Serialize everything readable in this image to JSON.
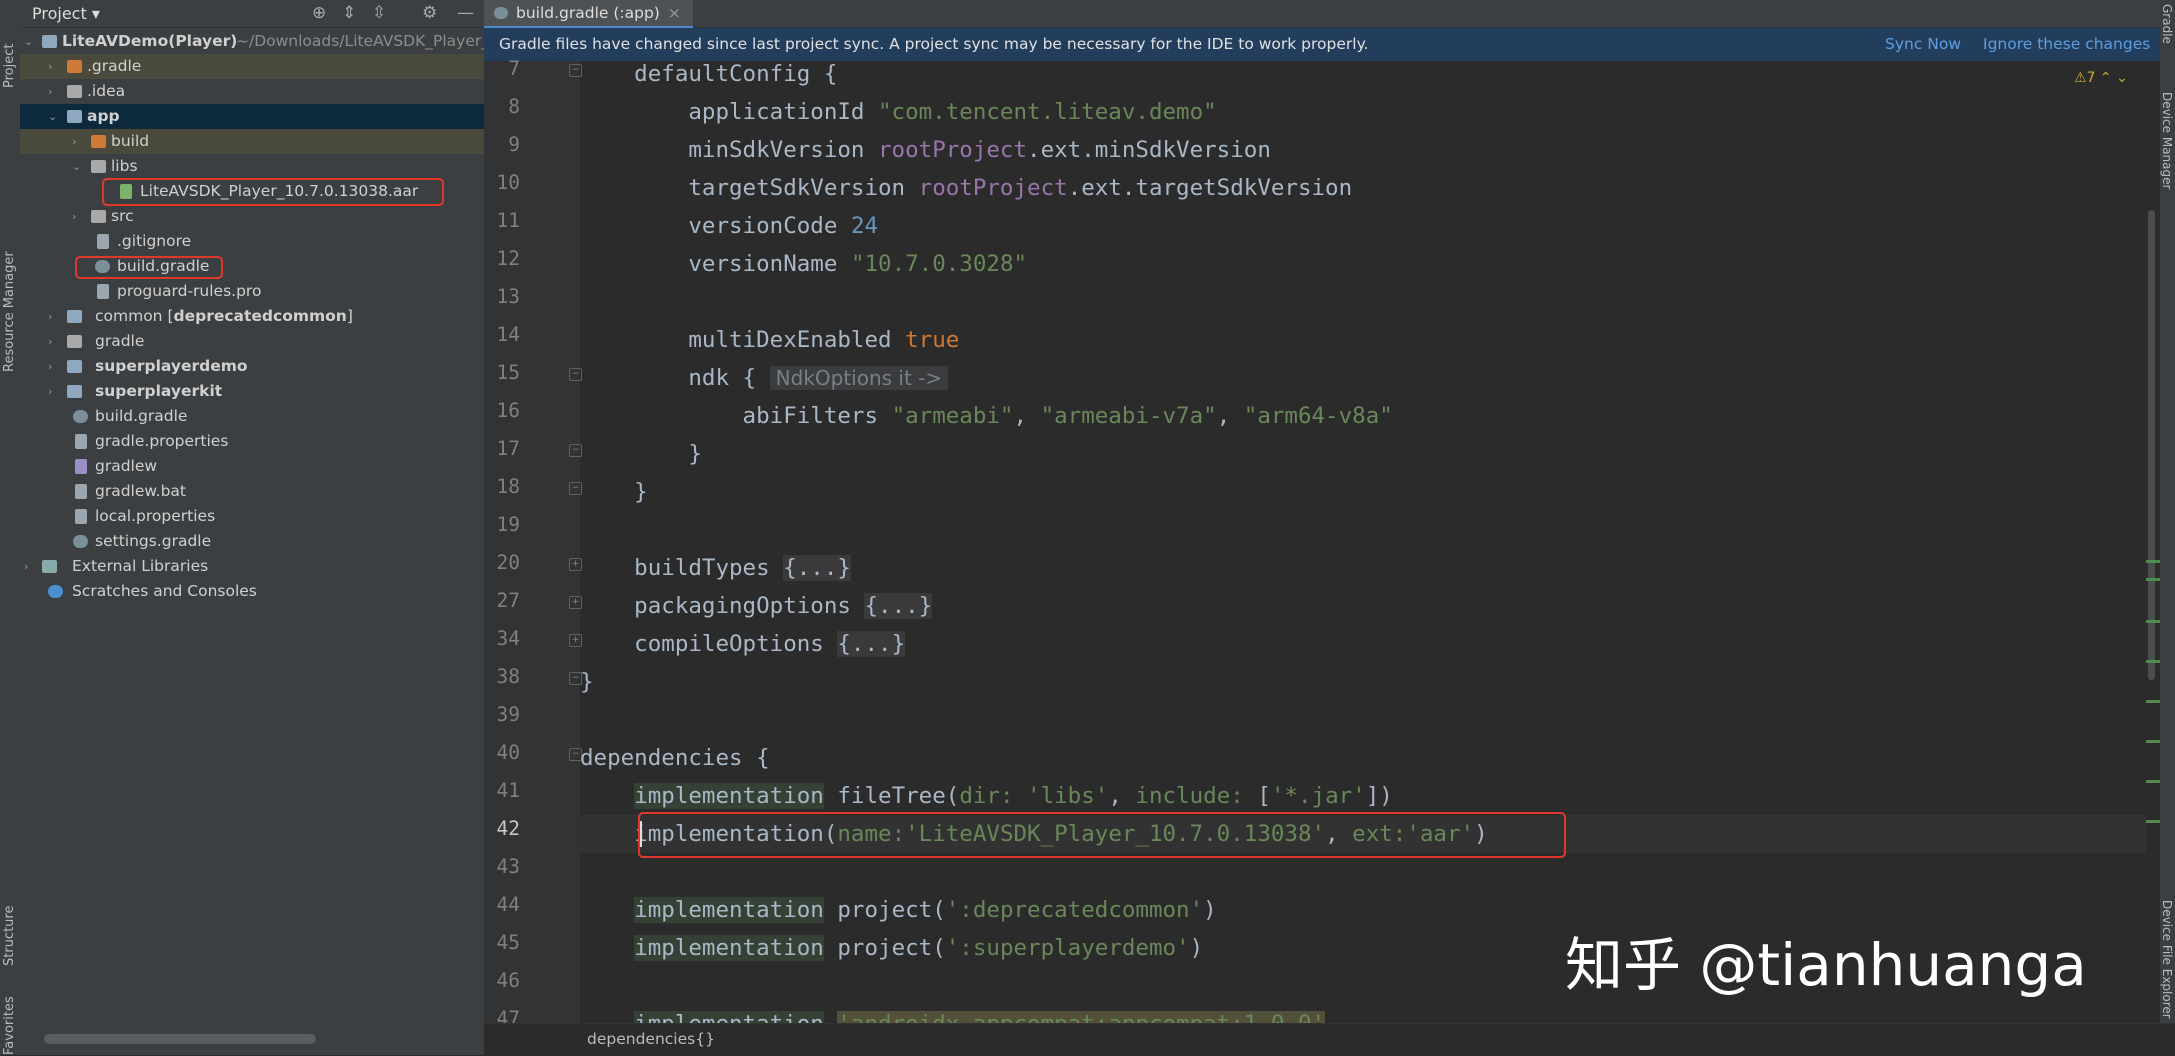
{
  "left_strip": {
    "tabs": [
      "Project",
      "Resource Manager",
      "Structure",
      "Favorites"
    ]
  },
  "right_strip": {
    "tabs": [
      "Gradle",
      "Device Manager",
      "Device File Explorer"
    ]
  },
  "project_panel": {
    "title": "Project",
    "title_arrow": "▾",
    "toolbar": {
      "locate": "⊕",
      "expand": "⇕",
      "collapse": "⇳",
      "settings": "⚙",
      "hide": "—"
    },
    "items": [
      {
        "label": "LiteAVDemo(Player)",
        "suffix": " ~/Downloads/LiteAVSDK_Player_A",
        "arrow": "⌄"
      },
      {
        "label": ".gradle",
        "arrow": "›"
      },
      {
        "label": ".idea",
        "arrow": "›"
      },
      {
        "label": "app",
        "arrow": "⌄"
      },
      {
        "label": "build",
        "arrow": "›"
      },
      {
        "label": "libs",
        "arrow": "⌄"
      },
      {
        "label": "LiteAVSDK_Player_10.7.0.13038.aar"
      },
      {
        "label": "src",
        "arrow": "›"
      },
      {
        "label": ".gitignore"
      },
      {
        "label": "build.gradle"
      },
      {
        "label": "proguard-rules.pro"
      },
      {
        "label": "common",
        "suffix_open": " [",
        "suffix_bold": "deprecatedcommon",
        "suffix_close": "]",
        "arrow": "›"
      },
      {
        "label": "gradle",
        "arrow": "›"
      },
      {
        "label": "superplayerdemo",
        "arrow": "›"
      },
      {
        "label": "superplayerkit",
        "arrow": "›"
      },
      {
        "label": "build.gradle"
      },
      {
        "label": "gradle.properties"
      },
      {
        "label": "gradlew"
      },
      {
        "label": "gradlew.bat"
      },
      {
        "label": "local.properties"
      },
      {
        "label": "settings.gradle"
      },
      {
        "label": "External Libraries",
        "arrow": "›"
      },
      {
        "label": "Scratches and Consoles"
      }
    ]
  },
  "editor": {
    "tab_label": "build.gradle (:app)",
    "tab_close": "×",
    "notice": "Gradle files have changed since last project sync. A project sync may be necessary for the IDE to work properly.",
    "sync_now": "Sync Now",
    "ignore": "Ignore these changes",
    "warnings": "⚠7 ⌃ ⌄",
    "breadcrumb": "dependencies{}",
    "fold_plus": "+",
    "fold_minus": "−",
    "bulb": "💡",
    "line_numbers": [
      "7",
      "8",
      "9",
      "10",
      "11",
      "12",
      "13",
      "14",
      "15",
      "16",
      "17",
      "18",
      "19",
      "20",
      "27",
      "34",
      "38",
      "39",
      "40",
      "41",
      "42",
      "43",
      "44",
      "45",
      "46",
      "47"
    ],
    "code": {
      "l7": "    defaultConfig {",
      "l8a": "        applicationId ",
      "l8b": "\"com.tencent.liteav.demo\"",
      "l9a": "        minSdkVersion ",
      "l9b": "rootProject",
      "l9c": ".ext.minSdkVersion",
      "l10a": "        targetSdkVersion ",
      "l10b": "rootProject",
      "l10c": ".ext.targetSdkVersion",
      "l11a": "        versionCode ",
      "l11b": "24",
      "l12a": "        versionName ",
      "l12b": "\"10.7.0.3028\"",
      "l14a": "        multiDexEnabled ",
      "l14b": "true",
      "l15a": "        ndk { ",
      "l15b": "NdkOptions it ->",
      "l16a": "            abiFilters ",
      "l16b": "\"armeabi\"",
      "l16c": ", ",
      "l16d": "\"armeabi-v7a\"",
      "l16e": ", ",
      "l16f": "\"arm64-v8a\"",
      "l17": "        }",
      "l18": "    }",
      "l20a": "    buildTypes ",
      "l20b": "{...}",
      "l27a": "    packagingOptions ",
      "l27b": "{...}",
      "l34a": "    compileOptions ",
      "l34b": "{...}",
      "l38": "}",
      "l40": "dependencies {",
      "l41a": "    ",
      "l41b": "implementation",
      "l41c": " fileTree(",
      "l41d": "dir: ",
      "l41e": "'libs'",
      "l41f": ", ",
      "l41g": "include: ",
      "l41h": "[",
      "l41i": "'*.jar'",
      "l41j": "])",
      "l42a": "    ",
      "l42b": "implementation",
      "l42c": "(",
      "l42d": "name:",
      "l42e": "'LiteAVSDK_Player_10.7.0.13038'",
      "l42f": ", ",
      "l42g": "ext:",
      "l42h": "'aar'",
      "l42i": ")",
      "l44a": "    ",
      "l44b": "implementation",
      "l44c": " project(",
      "l44d": "':deprecatedcommon'",
      "l44e": ")",
      "l45a": "    ",
      "l45b": "implementation",
      "l45c": " project(",
      "l45d": "':superplayerdemo'",
      "l45e": ")",
      "l47a": "    ",
      "l47b": "implementation",
      "l47c": " ",
      "l47d": "'androidx.appcompat:appcompat:1.0.0'"
    }
  },
  "watermark": "知乎 @tianhuanga"
}
